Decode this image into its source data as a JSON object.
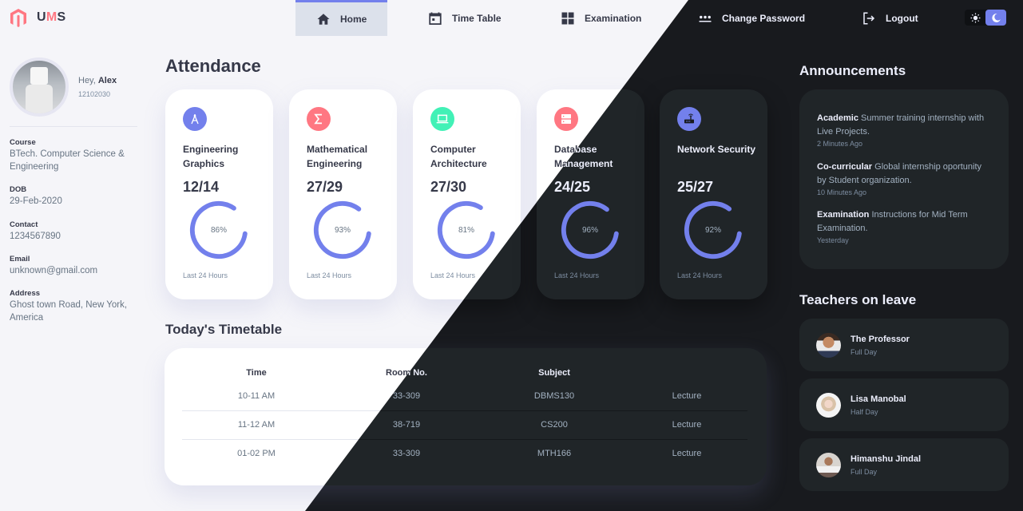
{
  "app": {
    "logo_u": "U",
    "logo_m": "M",
    "logo_s": "S",
    "brand_color": "#ff7782",
    "accent_color": "#7380ec"
  },
  "nav": {
    "home": "Home",
    "timetable": "Time Table",
    "examination": "Examination",
    "change_password": "Change Password",
    "logout": "Logout"
  },
  "theme_toggle": {
    "light_icon": "sun-icon",
    "dark_icon": "moon-icon",
    "active": "dark"
  },
  "profile": {
    "greeting": "Hey, ",
    "name": "Alex",
    "id": "12102030",
    "fields": [
      {
        "label": "Course",
        "value": "BTech. Computer Science & Engineering"
      },
      {
        "label": "DOB",
        "value": "29-Feb-2020"
      },
      {
        "label": "Contact",
        "value": "1234567890"
      },
      {
        "label": "Email",
        "value": "unknown@gmail.com"
      },
      {
        "label": "Address",
        "value": "Ghost town Road, New York, America"
      }
    ]
  },
  "attendance": {
    "title": "Attendance",
    "cards": [
      {
        "subject": "Engineering Graphics",
        "count": "12/14",
        "percent": 86,
        "percent_label": "86%",
        "footer": "Last 24 Hours",
        "icon": "compass-icon",
        "icon_color": "#7380ec"
      },
      {
        "subject": "Mathematical Engineering",
        "count": "27/29",
        "percent": 93,
        "percent_label": "93%",
        "footer": "Last 24 Hours",
        "icon": "sigma-icon",
        "icon_color": "#ff7782"
      },
      {
        "subject": "Computer Architecture",
        "count": "27/30",
        "percent": 81,
        "percent_label": "81%",
        "footer": "Last 24 Hours",
        "icon": "laptop-icon",
        "icon_color": "#41f1b6"
      },
      {
        "subject": "Database Management",
        "count": "24/25",
        "percent": 96,
        "percent_label": "96%",
        "footer": "Last 24 Hours",
        "icon": "database-icon",
        "icon_color": "#ff7782"
      },
      {
        "subject": "Network Security",
        "count": "25/27",
        "percent": 92,
        "percent_label": "92%",
        "footer": "Last 24 Hours",
        "icon": "router-icon",
        "icon_color": "#7380ec"
      }
    ]
  },
  "timetable": {
    "title": "Today's Timetable",
    "headers": [
      "Time",
      "Room No.",
      "Subject",
      ""
    ],
    "rows": [
      [
        "10-11 AM",
        "33-309",
        "DBMS130",
        "Lecture"
      ],
      [
        "11-12 AM",
        "38-719",
        "CS200",
        "Lecture"
      ],
      [
        "01-02 PM",
        "33-309",
        "MTH166",
        "Lecture"
      ]
    ]
  },
  "announcements": {
    "title": "Announcements",
    "items": [
      {
        "category": "Academic",
        "text": " Summer training internship with Live Projects.",
        "time": "2 Minutes Ago"
      },
      {
        "category": "Co-curricular",
        "text": " Global internship oportunity by Student organization.",
        "time": "10 Minutes Ago"
      },
      {
        "category": "Examination",
        "text": " Instructions for Mid Term Examination.",
        "time": "Yesterday"
      }
    ]
  },
  "leave": {
    "title": "Teachers on leave",
    "items": [
      {
        "name": "The Professor",
        "status": "Full Day"
      },
      {
        "name": "Lisa Manobal",
        "status": "Half Day"
      },
      {
        "name": "Himanshu Jindal",
        "status": "Full Day"
      }
    ]
  }
}
